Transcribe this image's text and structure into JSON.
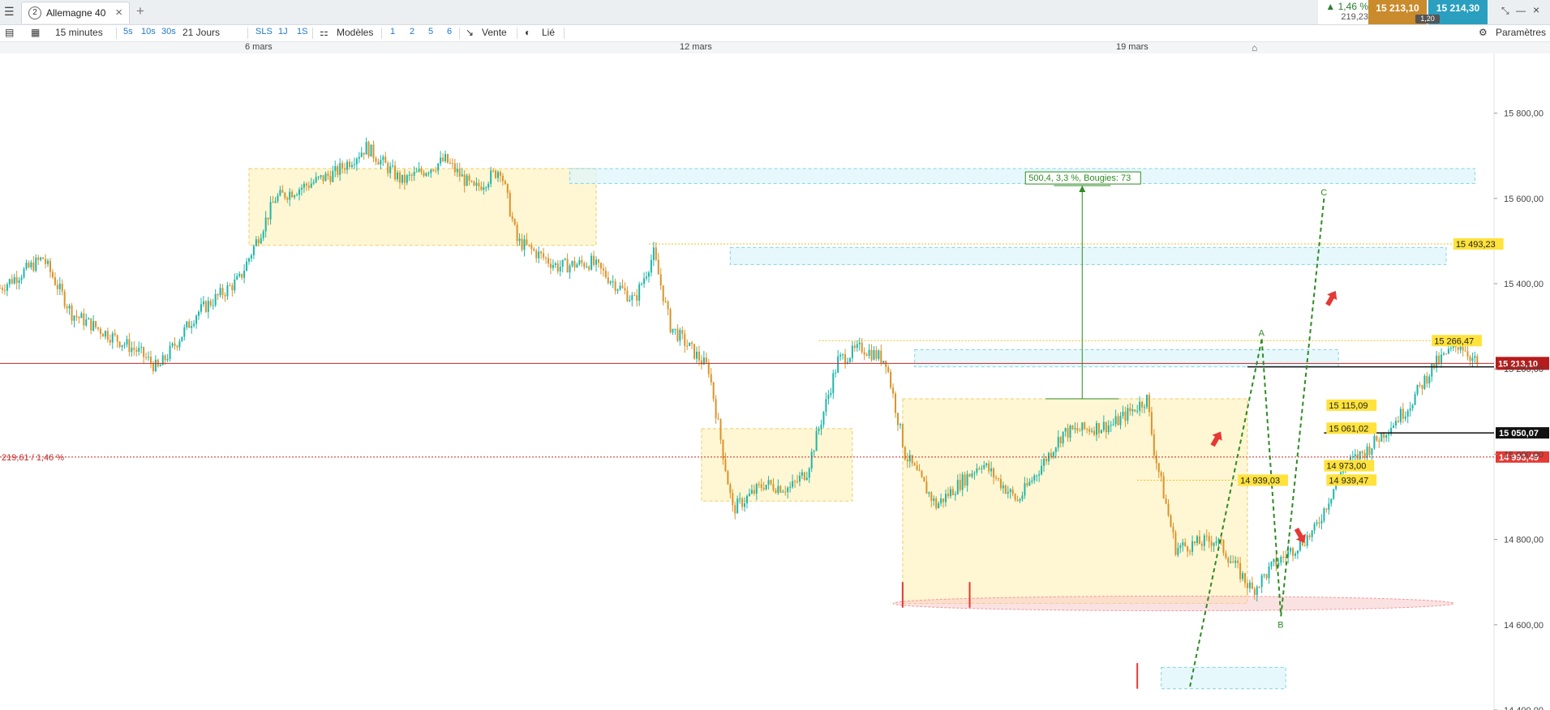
{
  "window": {
    "tab_number": "2",
    "tab_title": "Allemagne 40",
    "add_tab": "+",
    "change_pct": "▲ 1,46 %",
    "change_abs": "219,23",
    "bid": "15 213,10",
    "ask": "15 214,30",
    "spread": "1,20"
  },
  "toolbar": {
    "interval": "15 minutes",
    "quick_intervals": [
      "5s",
      "10s",
      "30s"
    ],
    "period": "21 Jours",
    "period_buttons": [
      "SLS",
      "1J",
      "1S"
    ],
    "models": "Modèles",
    "model_numbers": [
      "1",
      "2",
      "5",
      "6"
    ],
    "sell": "Vente",
    "linked": "Lié",
    "settings": "Paramètres"
  },
  "date_axis": [
    "6 mars",
    "12 mars",
    "19 mars"
  ],
  "colors": {
    "up": "#1fb5a8",
    "down": "#d9932a",
    "current_price": "#c62828",
    "zone_yellow": "#fff3c4",
    "zone_cyan": "#dff6fb",
    "trend": "#2e8b22",
    "arrow": "#e53935"
  },
  "chart_data": {
    "type": "candlestick",
    "title": "Allemagne 40",
    "interval": "15 minutes",
    "y_ticks": [
      14400,
      14600,
      14800,
      15000,
      15200,
      15400,
      15600,
      15800
    ],
    "y_tick_labels": [
      "14 400,00",
      "14 600,00",
      "14 800,00",
      "15 000,00",
      "15 200,00",
      "15 400,00",
      "15 600,00",
      "15 800,00"
    ],
    "ylim": [
      14400,
      15940
    ],
    "x_labels": [
      "6 mars",
      "12 mars",
      "19 mars"
    ],
    "price_path": [
      [
        0,
        15390
      ],
      [
        18,
        15460
      ],
      [
        30,
        15330
      ],
      [
        58,
        15240
      ],
      [
        66,
        15200
      ],
      [
        82,
        15330
      ],
      [
        100,
        15410
      ],
      [
        115,
        15600
      ],
      [
        140,
        15660
      ],
      [
        153,
        15720
      ],
      [
        168,
        15640
      ],
      [
        186,
        15690
      ],
      [
        198,
        15620
      ],
      [
        209,
        15670
      ],
      [
        216,
        15500
      ],
      [
        233,
        15440
      ],
      [
        247,
        15450
      ],
      [
        265,
        15360
      ],
      [
        273,
        15470
      ],
      [
        280,
        15300
      ],
      [
        296,
        15200
      ],
      [
        306,
        14870
      ],
      [
        319,
        14930
      ],
      [
        330,
        14920
      ],
      [
        337,
        14960
      ],
      [
        350,
        15220
      ],
      [
        360,
        15250
      ],
      [
        370,
        15220
      ],
      [
        378,
        15000
      ],
      [
        391,
        14880
      ],
      [
        410,
        14980
      ],
      [
        425,
        14890
      ],
      [
        444,
        15050
      ],
      [
        465,
        15070
      ],
      [
        479,
        15130
      ],
      [
        482,
        15010
      ],
      [
        491,
        14780
      ],
      [
        508,
        14800
      ],
      [
        523,
        14680
      ],
      [
        532,
        14740
      ],
      [
        549,
        14820
      ],
      [
        561,
        14970
      ],
      [
        571,
        15010
      ],
      [
        588,
        15110
      ],
      [
        599,
        15210
      ],
      [
        610,
        15260
      ],
      [
        617,
        15210
      ]
    ],
    "current_price": {
      "value": 15213.1,
      "label": "15 213,10"
    },
    "daily_reference": {
      "value": 14993.49,
      "label": "14 993,49",
      "left_label": "219,61 / 1,46 %"
    },
    "black_level": {
      "value": 15050.07,
      "label": "15 050,07"
    },
    "black_level_upper": {
      "value": 15205
    },
    "price_labels": [
      {
        "x": 607,
        "value": 15493.23,
        "text": "15 493,23"
      },
      {
        "x": 598,
        "value": 15266.47,
        "text": "15 266,47"
      },
      {
        "x": 554,
        "value": 15115.09,
        "text": "15 115,09"
      },
      {
        "x": 554,
        "value": 15061.02,
        "text": "15 061,02"
      },
      {
        "x": 553,
        "value": 14973.0,
        "text": "14 973,00"
      },
      {
        "x": 517,
        "value": 14939.03,
        "text": "14 939,03"
      },
      {
        "x": 554,
        "value": 14939.47,
        "text": "14 939,47"
      }
    ],
    "dotted_levels": [
      {
        "value": 15493.23,
        "x_start": 271,
        "x_end": 607,
        "color": "#e8c31a"
      },
      {
        "value": 15266.47,
        "x_start": 342,
        "x_end": 598,
        "color": "#e8c31a"
      },
      {
        "value": 14939.03,
        "x_start": 475,
        "x_end": 517,
        "color": "#e8c31a"
      }
    ],
    "zones": [
      {
        "x0": 104,
        "x1": 249,
        "y0": 15490,
        "y1": 15670,
        "color": "yellow"
      },
      {
        "x0": 293,
        "x1": 356,
        "y0": 14890,
        "y1": 15060,
        "color": "yellow"
      },
      {
        "x0": 377,
        "x1": 521,
        "y0": 14650,
        "y1": 15130,
        "color": "yellow"
      },
      {
        "x0": 238,
        "x1": 616,
        "y0": 15635,
        "y1": 15670,
        "color": "cyan"
      },
      {
        "x0": 305,
        "x1": 604,
        "y0": 15445,
        "y1": 15485,
        "color": "cyan"
      },
      {
        "x0": 382,
        "x1": 559,
        "y0": 15205,
        "y1": 15245,
        "color": "cyan"
      },
      {
        "x0": 485,
        "x1": 537,
        "y0": 14450,
        "y1": 14500,
        "color": "cyan"
      }
    ],
    "support_ellipse": {
      "x_start": 373,
      "x_end": 607,
      "value": 14650
    },
    "measure": {
      "text": "500,4, 3,3 %, Bougies: 73",
      "x": 452,
      "from": 15130,
      "to": 15630
    },
    "wave_points": [
      {
        "label": "A",
        "x": 527,
        "value": 15270
      },
      {
        "label": "B",
        "x": 535,
        "value": 14620
      },
      {
        "label": "C",
        "x": 553,
        "value": 15600
      }
    ],
    "trend_lines": [
      {
        "from": [
          497,
          14455
        ],
        "to": [
          527,
          15270
        ]
      },
      {
        "from": [
          527,
          15270
        ],
        "to": [
          535,
          14620
        ]
      },
      {
        "from": [
          535,
          14620
        ],
        "to": [
          553,
          15600
        ]
      }
    ],
    "signal_arrows": [
      {
        "x": 508,
        "value": 15035,
        "direction": "up"
      },
      {
        "x": 556,
        "value": 15365,
        "direction": "up"
      },
      {
        "x": 543,
        "value": 14810,
        "direction": "down"
      }
    ]
  }
}
